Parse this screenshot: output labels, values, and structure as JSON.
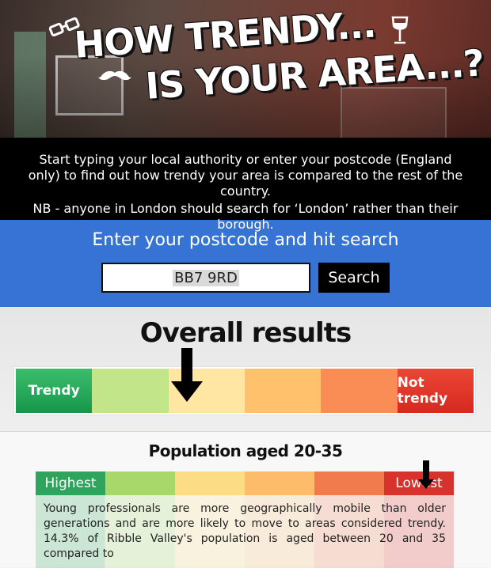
{
  "hero": {
    "title_line1": "HOW TRENDY...",
    "title_line2": "IS YOUR AREA...?"
  },
  "intro": {
    "line1": "Start typing your local authority or enter your postcode (England only) to find out how trendy your area is compared to the rest of the country.",
    "line2": "NB - anyone in London should search for ‘London’ rather than their borough."
  },
  "search": {
    "heading": "Enter your postcode and hit search",
    "value": "BB7 9RD",
    "button_label": "Search"
  },
  "overall": {
    "heading": "Overall results",
    "left_label": "Trendy",
    "right_label": "Not trendy",
    "segment_count": 6,
    "marker_segment": 3
  },
  "population": {
    "heading": "Population aged 20-35",
    "left_label": "Highest",
    "right_label": "Lowest",
    "marker_segment": 6,
    "text": "Young professionals are more geographically mobile than older generations and are more likely to move to areas considered trendy. 14.3% of Ribble Valley's population is aged between 20 and 35 compared to"
  },
  "icons": [
    "glasses-icon",
    "mustache-icon",
    "wine-glass-icon",
    "down-arrow-icon"
  ],
  "colors": {
    "search_bg": "#3673d4",
    "trendy": "#17964a",
    "not_trendy": "#d6291f"
  }
}
